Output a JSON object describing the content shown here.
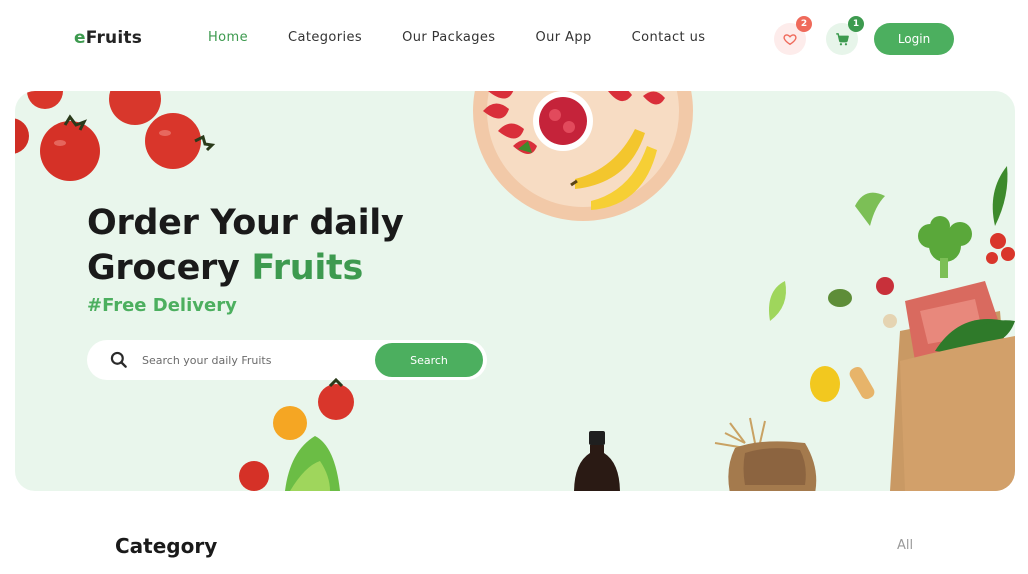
{
  "brand": {
    "prefix": "e",
    "name": "Fruits"
  },
  "nav": {
    "items": [
      {
        "label": "Home",
        "active": true
      },
      {
        "label": "Categories",
        "active": false
      },
      {
        "label": "Our Packages",
        "active": false
      },
      {
        "label": "Our App",
        "active": false
      },
      {
        "label": "Contact us",
        "active": false
      }
    ],
    "wishlist": {
      "icon": "heart-icon",
      "count": "2"
    },
    "cart": {
      "icon": "cart-icon",
      "count": "1"
    },
    "login_label": "Login"
  },
  "hero": {
    "headline_line1": "Order Your daily",
    "headline_line2": "Grocery",
    "headline_highlight": "Fruits",
    "tagline": "#Free Delivery",
    "search": {
      "icon": "search-icon",
      "placeholder": "Search your daily Fruits",
      "button_label": "Search"
    }
  },
  "category": {
    "title": "Category",
    "all_label": "All"
  },
  "colors": {
    "accent": "#4caf5f",
    "hero_bg": "#e9f6ec",
    "badge_red": "#ef6a5b"
  }
}
